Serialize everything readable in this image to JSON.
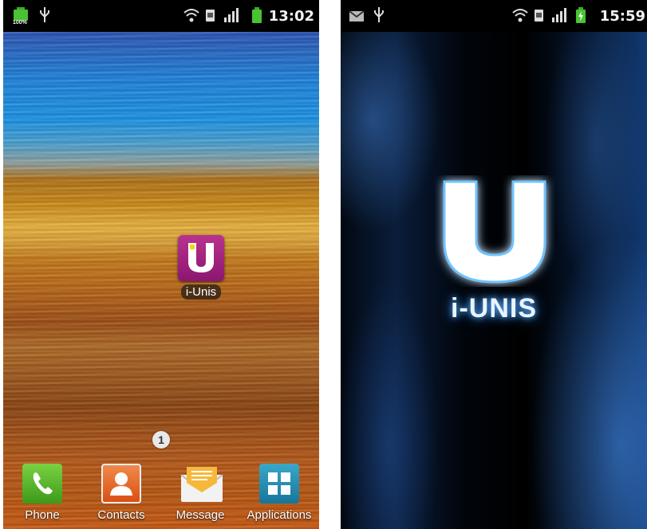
{
  "left_screen": {
    "status_bar": {
      "time": "13:02",
      "battery_text": "100%"
    },
    "home_shortcut": {
      "label": "i-Unis",
      "icon": "i-unis-app-icon"
    },
    "page_indicator": "1",
    "dock": [
      {
        "label": "Phone",
        "icon": "phone-icon"
      },
      {
        "label": "Contacts",
        "icon": "contacts-icon"
      },
      {
        "label": "Message",
        "icon": "message-icon"
      },
      {
        "label": "Applications",
        "icon": "applications-grid-icon"
      }
    ]
  },
  "right_screen": {
    "status_bar": {
      "time": "15:59"
    },
    "splash": {
      "logo_letter": "U",
      "title": "i-UNIS"
    }
  },
  "colors": {
    "status_bar": "#000000",
    "app_tile": "#9a1e7a",
    "splash_glow": "#5fb2ff"
  }
}
